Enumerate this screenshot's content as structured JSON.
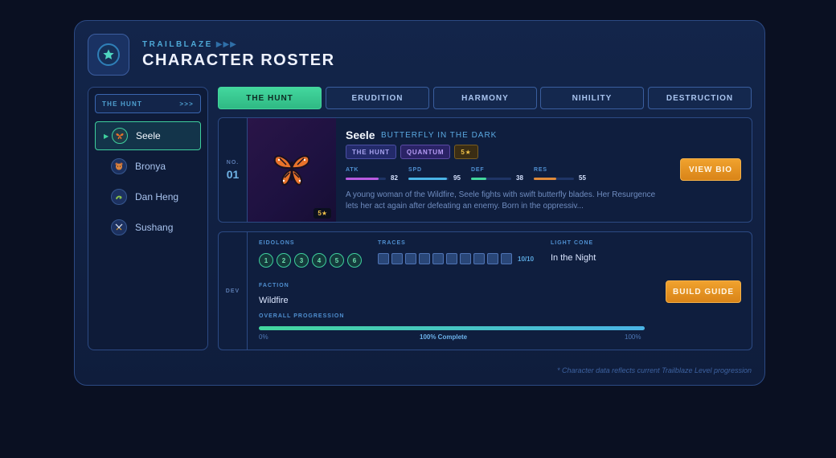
{
  "header": {
    "eyebrow": "TRAILBLAZE",
    "eyebrow_arrows": "▶▶▶",
    "title": "CHARACTER ROSTER",
    "icon": "star-icon"
  },
  "sidebar": {
    "heading": "THE HUNT",
    "heading_arrows": ">>>",
    "items": [
      {
        "label": "Seele",
        "icon": "butterfly-icon",
        "active": true
      },
      {
        "label": "Bronya",
        "icon": "bear-icon",
        "active": false
      },
      {
        "label": "Dan Heng",
        "icon": "dragon-icon",
        "active": false
      },
      {
        "label": "Sushang",
        "icon": "swords-icon",
        "active": false
      }
    ]
  },
  "tabs": [
    {
      "label": "THE HUNT",
      "active": true
    },
    {
      "label": "ERUDITION",
      "active": false
    },
    {
      "label": "HARMONY",
      "active": false
    },
    {
      "label": "NIHILITY",
      "active": false
    },
    {
      "label": "DESTRUCTION",
      "active": false
    }
  ],
  "character": {
    "no_label": "NO.",
    "number": "01",
    "name": "Seele",
    "epithet": "BUTTERFLY IN THE DARK",
    "rarity_badge": "5★",
    "tags": [
      "THE HUNT",
      "QUANTUM",
      "5★"
    ],
    "stats": [
      {
        "label": "ATK",
        "value": "82",
        "level": 0.82,
        "color": "#b85ae0"
      },
      {
        "label": "SPD",
        "value": "95",
        "level": 0.95,
        "color": "#4ab4e6"
      },
      {
        "label": "DEF",
        "value": "38",
        "level": 0.38,
        "color": "#43d79e"
      },
      {
        "label": "RES",
        "value": "55",
        "level": 0.55,
        "color": "#e08a3a"
      }
    ],
    "description": "A young woman of the Wildfire, Seele fights with swift butterfly blades. Her Resurgence lets her act again after defeating an enemy. Born in the oppressiv...",
    "view_bio": "VIEW BIO"
  },
  "dev": {
    "side_label": "DEV",
    "eidolons_label": "EIDOLONS",
    "eidolons": [
      "1",
      "2",
      "3",
      "4",
      "5",
      "6"
    ],
    "traces_label": "TRACES",
    "traces_count": 10,
    "traces_text": "10/10",
    "light_cone_label": "LIGHT CONE",
    "light_cone": "In the Night",
    "faction_label": "FACTION",
    "faction": "Wildfire",
    "build_guide": "BUILD GUIDE",
    "progression_label": "OVERALL PROGRESSION",
    "progression": 1.0,
    "prog_min": "0%",
    "prog_status": "100% Complete",
    "prog_max": "100%"
  },
  "footer_note": "* Character data reflects current Trailblaze Level progression"
}
